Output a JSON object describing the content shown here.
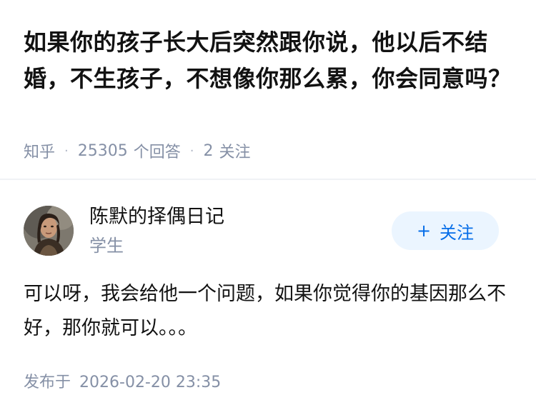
{
  "question": {
    "title": "如果你的孩子长大后突然跟你说，他以后不结婚，不生孩子，不想像你那么累，你会同意吗？",
    "source": "知乎",
    "answer_count": "25305",
    "answer_unit": "个回答",
    "follow_count": "2",
    "follow_unit": "关注",
    "separator": "·"
  },
  "answer": {
    "author_name": "陈默的择偶日记",
    "author_role": "学生",
    "follow_button_label": "关注",
    "follow_button_icon": "plus-icon",
    "content": "可以呀，我会给他一个问题，如果你觉得你的基因那么不好，那你就可以。。。",
    "publish_label": "发布于",
    "publish_time": "2026-02-20 23:35"
  },
  "colors": {
    "title": "#121212",
    "meta": "#8590a6",
    "brand_blue": "#056de8",
    "button_bg": "#ebf5ff",
    "divider": "#f0f2f5"
  }
}
